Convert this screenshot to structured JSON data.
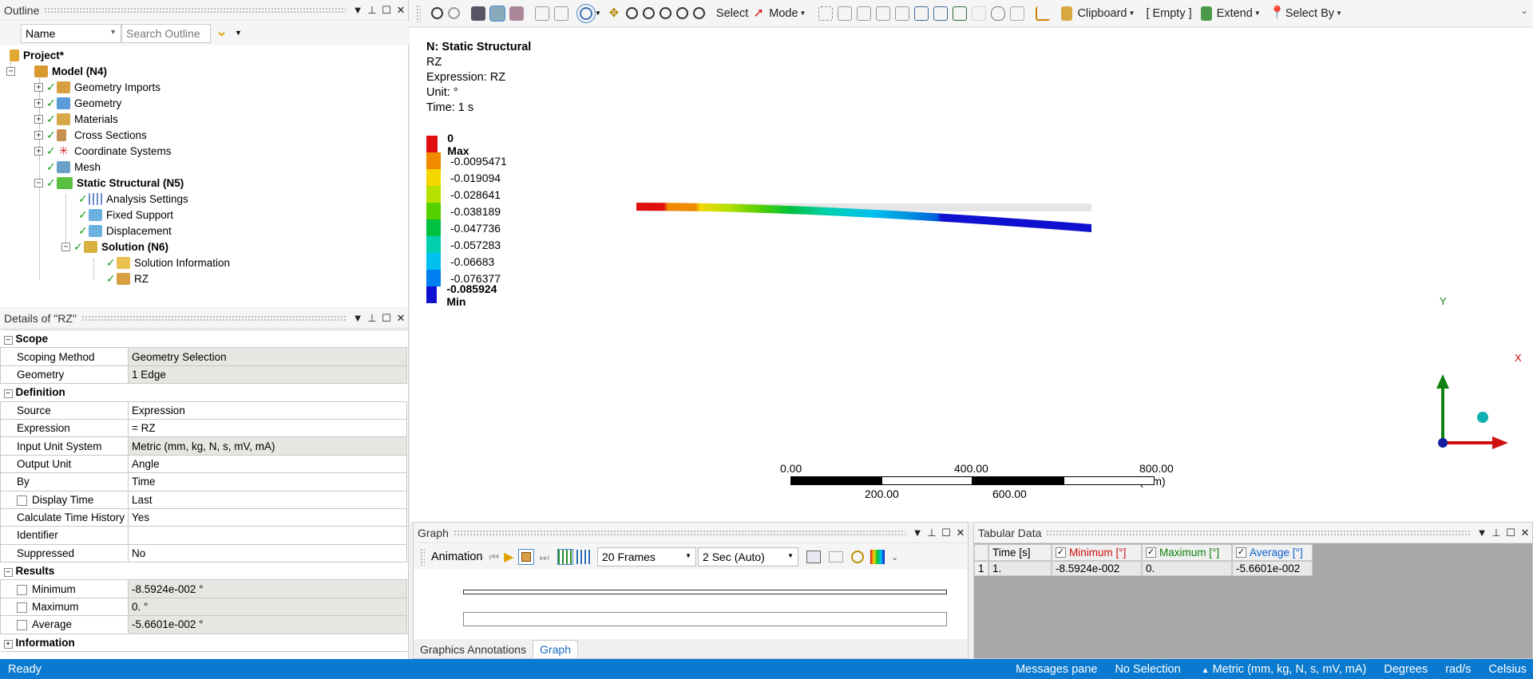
{
  "outline": {
    "title": "Outline",
    "name_filter": "Name",
    "search_placeholder": "Search Outline",
    "tree": [
      {
        "label": "Project*",
        "bold": true
      },
      {
        "label": "Model (N4)",
        "bold": true
      },
      {
        "label": "Geometry Imports"
      },
      {
        "label": "Geometry"
      },
      {
        "label": "Materials"
      },
      {
        "label": "Cross Sections"
      },
      {
        "label": "Coordinate Systems"
      },
      {
        "label": "Mesh"
      },
      {
        "label": "Static Structural (N5)",
        "bold": true
      },
      {
        "label": "Analysis Settings"
      },
      {
        "label": "Fixed Support"
      },
      {
        "label": "Displacement"
      },
      {
        "label": "Solution (N6)",
        "bold": true
      },
      {
        "label": "Solution Information"
      },
      {
        "label": "RZ"
      }
    ]
  },
  "details": {
    "title": "Details of \"RZ\"",
    "sections": {
      "scope": "Scope",
      "definition": "Definition",
      "results": "Results",
      "information": "Information"
    },
    "rows": {
      "scoping_method": {
        "k": "Scoping Method",
        "v": "Geometry Selection"
      },
      "geometry": {
        "k": "Geometry",
        "v": "1 Edge"
      },
      "source": {
        "k": "Source",
        "v": "Expression"
      },
      "expression": {
        "k": "Expression",
        "v": "= RZ"
      },
      "input_unit": {
        "k": "Input Unit System",
        "v": "Metric (mm, kg, N, s, mV, mA)"
      },
      "output_unit": {
        "k": "Output Unit",
        "v": "Angle"
      },
      "by": {
        "k": "By",
        "v": "Time"
      },
      "display_time": {
        "k": "Display Time",
        "v": "Last"
      },
      "calc_time_history": {
        "k": "Calculate Time History",
        "v": "Yes"
      },
      "identifier": {
        "k": "Identifier",
        "v": ""
      },
      "suppressed": {
        "k": "Suppressed",
        "v": "No"
      },
      "minimum": {
        "k": "Minimum",
        "v": "-8.5924e-002 °"
      },
      "maximum": {
        "k": "Maximum",
        "v": "0. °"
      },
      "average": {
        "k": "Average",
        "v": "-5.6601e-002 °"
      }
    }
  },
  "toolbar": {
    "select": "Select",
    "mode": "Mode",
    "clipboard": "Clipboard",
    "empty": "[ Empty ]",
    "extend": "Extend",
    "select_by": "Select By"
  },
  "viewport": {
    "info": {
      "title": "N: Static Structural",
      "result": "RZ",
      "expression": "Expression: RZ",
      "unit": "Unit: °",
      "time": "Time: 1 s"
    },
    "legend": [
      {
        "label": "0 Max",
        "color": "#e01010",
        "bold": true
      },
      {
        "label": "-0.0095471",
        "color": "#f08a00"
      },
      {
        "label": "-0.019094",
        "color": "#f4d800"
      },
      {
        "label": "-0.028641",
        "color": "#b8e000"
      },
      {
        "label": "-0.038189",
        "color": "#55d000"
      },
      {
        "label": "-0.047736",
        "color": "#00c040"
      },
      {
        "label": "-0.057283",
        "color": "#00d0b0"
      },
      {
        "label": "-0.06683",
        "color": "#00c0f0"
      },
      {
        "label": "-0.076377",
        "color": "#0080f0"
      },
      {
        "label": "-0.085924 Min",
        "color": "#1010d0",
        "bold": true
      }
    ],
    "scale": {
      "top_labels": [
        "0.00",
        "400.00",
        "800.00 (mm)"
      ],
      "bottom_labels": [
        "200.00",
        "600.00"
      ]
    },
    "axes": {
      "y": "Y",
      "x": "X"
    }
  },
  "graph": {
    "title": "Graph",
    "animation_label": "Animation",
    "frames": "20 Frames",
    "duration": "2 Sec (Auto)",
    "tabs": [
      "Graphics Annotations",
      "Graph"
    ]
  },
  "tabular": {
    "title": "Tabular Data",
    "headers": {
      "time": "Time [s]",
      "min": "Minimum [°]",
      "max": "Maximum [°]",
      "avg": "Average [°]"
    },
    "row": {
      "idx": "1",
      "time": "1.",
      "min": "-8.5924e-002",
      "max": "0.",
      "avg": "-5.6601e-002"
    },
    "colors": {
      "min": "#d01010",
      "max": "#108010",
      "avg": "#1060d0"
    }
  },
  "status": {
    "ready": "Ready",
    "messages": "Messages pane",
    "selection": "No Selection",
    "units": "Metric (mm, kg, N, s, mV, mA)",
    "angle": "Degrees",
    "rot": "rad/s",
    "temp": "Celsius"
  }
}
